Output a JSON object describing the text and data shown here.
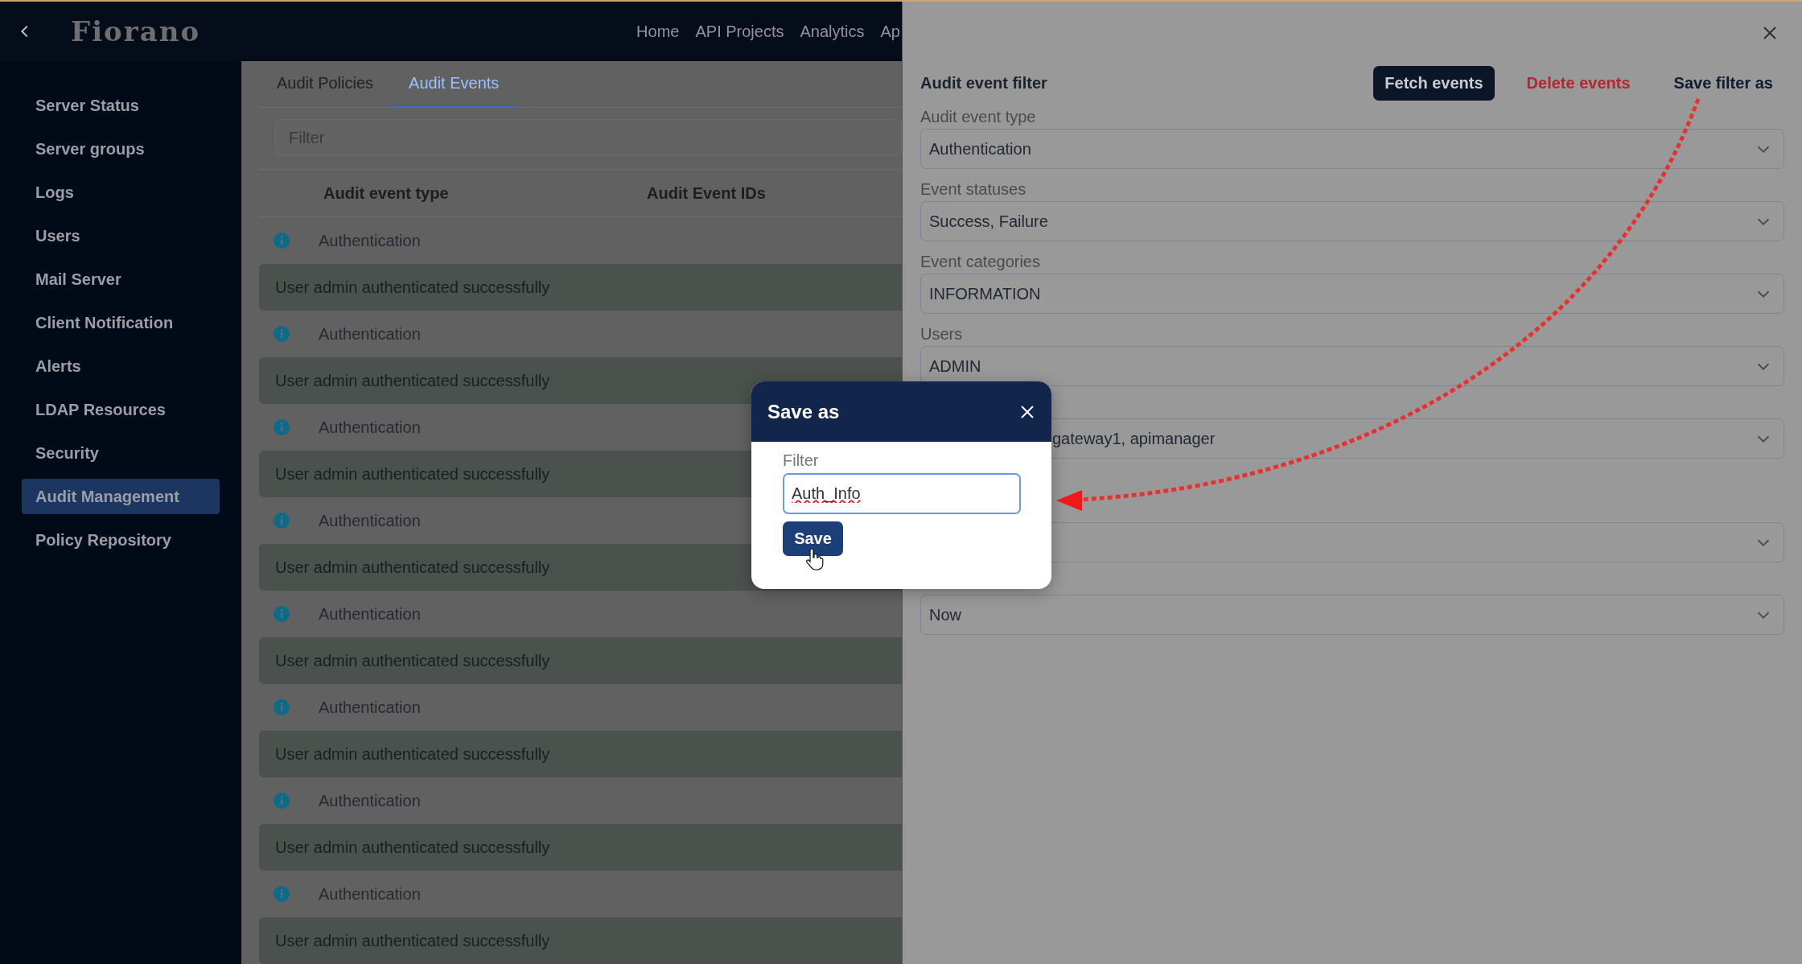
{
  "header": {
    "logo": "Fiorano",
    "nav": [
      "Home",
      "API Projects",
      "Analytics",
      "Ap"
    ]
  },
  "sidebar": {
    "items": [
      {
        "label": "Server Status",
        "selected": false
      },
      {
        "label": "Server groups",
        "selected": false
      },
      {
        "label": "Logs",
        "selected": false
      },
      {
        "label": "Users",
        "selected": false
      },
      {
        "label": "Mail Server",
        "selected": false
      },
      {
        "label": "Client Notification",
        "selected": false
      },
      {
        "label": "Alerts",
        "selected": false
      },
      {
        "label": "LDAP Resources",
        "selected": false
      },
      {
        "label": "Security",
        "selected": false
      },
      {
        "label": "Audit Management",
        "selected": true
      },
      {
        "label": "Policy Repository",
        "selected": false
      }
    ]
  },
  "tabs": [
    {
      "label": "Audit Policies",
      "selected": false
    },
    {
      "label": "Audit Events",
      "selected": true
    }
  ],
  "filter": {
    "placeholder": "Filter"
  },
  "table": {
    "columns": [
      "Audit event type",
      "Audit Event IDs"
    ],
    "rows": [
      {
        "type": "Authentication",
        "message": "User admin authenticated successfully"
      },
      {
        "type": "Authentication",
        "message": "User admin authenticated successfully"
      },
      {
        "type": "Authentication",
        "message": "User admin authenticated successfully"
      },
      {
        "type": "Authentication",
        "message": "User admin authenticated successfully"
      },
      {
        "type": "Authentication",
        "message": "User admin authenticated successfully"
      },
      {
        "type": "Authentication",
        "message": "User admin authenticated successfully"
      },
      {
        "type": "Authentication",
        "message": "User admin authenticated successfully"
      },
      {
        "type": "Authentication",
        "message": "User admin authenticated successfully"
      }
    ]
  },
  "panel": {
    "title": "Audit event filter",
    "actions": [
      {
        "label": "Fetch events",
        "kind": "primary"
      },
      {
        "label": "Delete events",
        "kind": "danger"
      },
      {
        "label": "Save filter as",
        "kind": "plain"
      }
    ],
    "fields": [
      {
        "label": "Audit event type",
        "value": "Authentication",
        "covered": false
      },
      {
        "label": "Event statuses",
        "value": "Success, Failure",
        "covered": false
      },
      {
        "label": "Event categories",
        "value": "INFORMATION",
        "covered": false
      },
      {
        "label": "Users",
        "value": "ADMIN",
        "covered": false
      },
      {
        "value": "gateway1, apimanager",
        "covered": true
      },
      {
        "covered": true
      },
      {
        "value": "Now",
        "covered": false
      }
    ]
  },
  "dialog": {
    "title": "Save as",
    "field_label": "Filter",
    "value": "Auth_Info",
    "misspelled": true,
    "button": "Save"
  }
}
